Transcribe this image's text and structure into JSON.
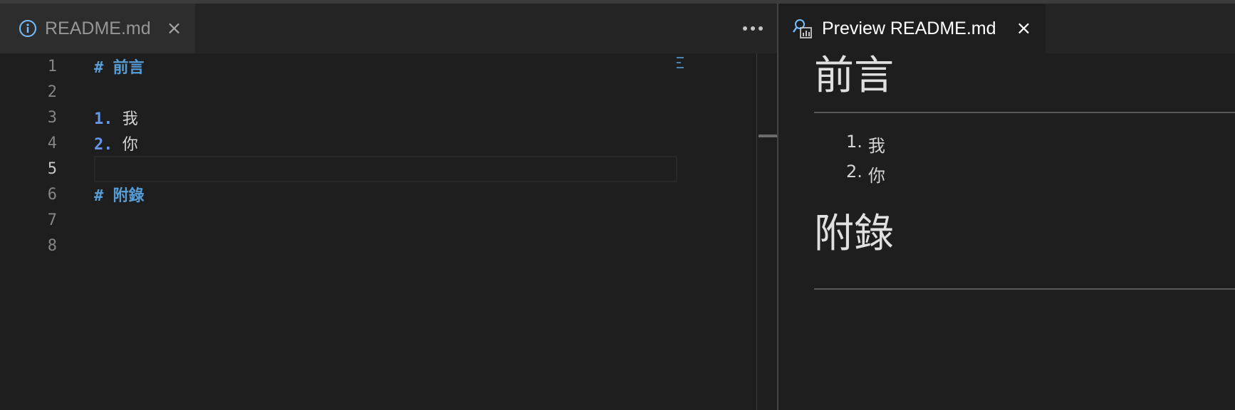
{
  "editor_tab": {
    "label": "README.md",
    "icon": "info-icon",
    "close": "×"
  },
  "editor": {
    "lines": [
      {
        "num": "1",
        "marker": "#",
        "text": "前言"
      },
      {
        "num": "2",
        "marker": "",
        "text": ""
      },
      {
        "num": "3",
        "marker": "1.",
        "text": "我"
      },
      {
        "num": "4",
        "marker": "2.",
        "text": "你"
      },
      {
        "num": "5",
        "marker": "",
        "text": ""
      },
      {
        "num": "6",
        "marker": "#",
        "text": "附錄"
      },
      {
        "num": "7",
        "marker": "",
        "text": ""
      },
      {
        "num": "8",
        "marker": "",
        "text": ""
      }
    ],
    "current_line": "5"
  },
  "preview_tab": {
    "label": "Preview README.md",
    "icon": "preview-icon",
    "close": "×"
  },
  "preview": {
    "heading1": "前言",
    "list": [
      {
        "num": "1.",
        "text": "我"
      },
      {
        "num": "2.",
        "text": "你"
      }
    ],
    "heading2": "附錄"
  },
  "colors": {
    "heading_token": "#569cd6",
    "list_token": "#6796e6",
    "background": "#1e1e1e",
    "tabbar": "#252526"
  }
}
